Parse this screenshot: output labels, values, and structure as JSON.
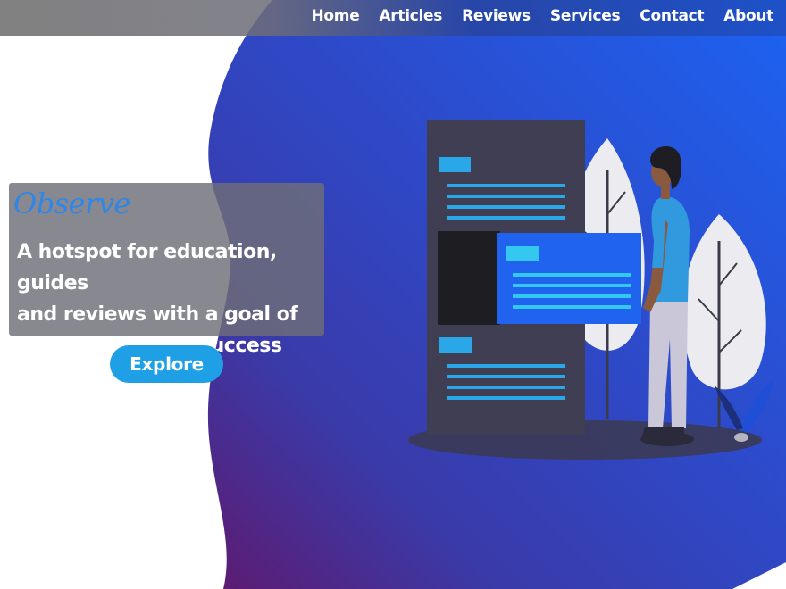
{
  "nav": {
    "items": [
      "Home",
      "Articles",
      "Reviews",
      "Services",
      "Contact",
      "About"
    ]
  },
  "hero": {
    "brand": "Observe",
    "tagline_line1": "A hotspot for education, guides",
    "tagline_line2": "and reviews with a goal of",
    "tagline_line3": "productivity and success",
    "cta_label": "Explore"
  },
  "colors": {
    "blob_top": "#1f5ff0",
    "blob_bottom": "#5a1a78",
    "accent": "#1fa0e6",
    "brand_text": "#2f86e6"
  },
  "icons": {
    "illustration": "person-with-document-illustration"
  }
}
